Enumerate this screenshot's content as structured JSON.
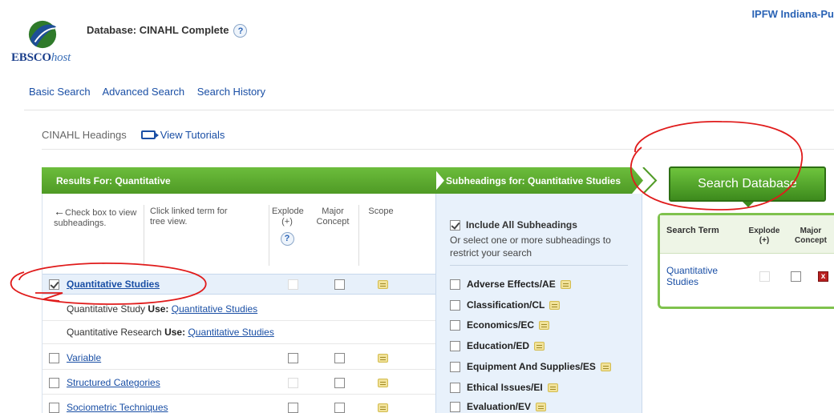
{
  "header": {
    "logo_text": "EBSCO",
    "logo_text_italic": "host",
    "database_label": "Database: CINAHL Complete",
    "help_glyph": "?",
    "institution": "IPFW Indiana-Pu"
  },
  "nav": {
    "basic_search": "Basic Search",
    "advanced_search": "Advanced Search",
    "search_history": "Search History"
  },
  "subnav": {
    "headings_label": "CINAHL Headings",
    "view_tutorials": "View Tutorials"
  },
  "results": {
    "title": "Results For: Quantitative",
    "col_check": "Check box to view subheadings.",
    "col_click": "Click linked term for tree view.",
    "col_explode": "Explode (+)",
    "col_major": "Major Concept",
    "col_scope": "Scope",
    "rows": [
      {
        "term": "Quantitative Studies"
      },
      {
        "use_term": "Quantitative Study",
        "use_word": "Use:",
        "use_link": "Quantitative Studies"
      },
      {
        "use_term": "Quantitative Research",
        "use_word": "Use:",
        "use_link": "Quantitative Studies"
      },
      {
        "term": "Variable"
      },
      {
        "term": "Structured Categories"
      },
      {
        "term": "Sociometric Techniques"
      }
    ]
  },
  "subheadings": {
    "title": "Subheadings for: Quantitative Studies",
    "include_all": "Include All Subheadings",
    "instruction": "Or select one or more subheadings to restrict your search",
    "items": [
      "Adverse Effects/AE",
      "Classification/CL",
      "Economics/EC",
      "Education/ED",
      "Equipment And Supplies/ES",
      "Ethical Issues/EI",
      "Evaluation/EV"
    ]
  },
  "search_panel": {
    "button": "Search Database",
    "col_term": "Search Term",
    "col_explode_1": "Explode",
    "col_explode_2": "(+)",
    "col_major_1": "Major",
    "col_major_2": "Concept",
    "term": "Quantitative Studies",
    "delete_glyph": "x"
  },
  "colors": {
    "brand_green": "#4f9a25",
    "link_blue": "#1a4fa5",
    "annotation_red": "#e01b1b"
  }
}
